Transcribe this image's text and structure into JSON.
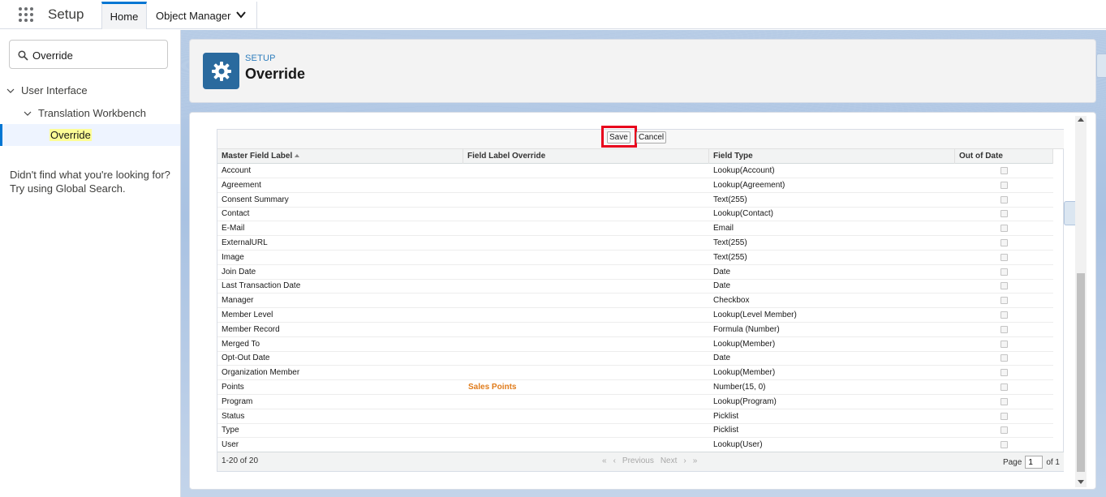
{
  "topbar": {
    "app_title": "Setup",
    "tab_home": "Home",
    "tab_object_manager": "Object Manager"
  },
  "sidebar": {
    "search_value": "Override",
    "tree": {
      "level1": "User Interface",
      "level2": "Translation Workbench",
      "level3_selected": "Override"
    },
    "help_line1": "Didn't find what you're looking for?",
    "help_line2": "Try using Global Search."
  },
  "header": {
    "breadcrumb": "SETUP",
    "title": "Override"
  },
  "buttons": {
    "save": "Save",
    "cancel": "Cancel"
  },
  "table": {
    "columns": [
      "Master Field Label",
      "Field Label Override",
      "Field Type",
      "Out of Date"
    ],
    "rows": [
      {
        "label": "Account",
        "override": "",
        "type": "Lookup(Account)"
      },
      {
        "label": "Agreement",
        "override": "",
        "type": "Lookup(Agreement)"
      },
      {
        "label": "Consent Summary",
        "override": "",
        "type": "Text(255)"
      },
      {
        "label": "Contact",
        "override": "",
        "type": "Lookup(Contact)"
      },
      {
        "label": "E-Mail",
        "override": "",
        "type": "Email"
      },
      {
        "label": "ExternalURL",
        "override": "",
        "type": "Text(255)"
      },
      {
        "label": "Image",
        "override": "",
        "type": "Text(255)"
      },
      {
        "label": "Join Date",
        "override": "",
        "type": "Date"
      },
      {
        "label": "Last Transaction Date",
        "override": "",
        "type": "Date"
      },
      {
        "label": "Manager",
        "override": "",
        "type": "Checkbox"
      },
      {
        "label": "Member Level",
        "override": "",
        "type": "Lookup(Level Member)"
      },
      {
        "label": "Member Record",
        "override": "",
        "type": "Formula (Number)"
      },
      {
        "label": "Merged To",
        "override": "",
        "type": "Lookup(Member)"
      },
      {
        "label": "Opt-Out Date",
        "override": "",
        "type": "Date"
      },
      {
        "label": "Organization Member",
        "override": "",
        "type": "Lookup(Member)"
      },
      {
        "label": "Points",
        "override": "Sales Points",
        "type": "Number(15, 0)"
      },
      {
        "label": "Program",
        "override": "",
        "type": "Lookup(Program)"
      },
      {
        "label": "Status",
        "override": "",
        "type": "Picklist"
      },
      {
        "label": "Type",
        "override": "",
        "type": "Picklist"
      },
      {
        "label": "User",
        "override": "",
        "type": "Lookup(User)"
      }
    ]
  },
  "footer": {
    "count": "1-20 of 20",
    "previous": "Previous",
    "next": "Next",
    "page_label": "Page",
    "page_value": "1",
    "of_label": "of 1"
  },
  "colors": {
    "accent": "#0176d3",
    "header_icon": "#2a6a9e",
    "highlight_box": "#e8001c",
    "override_text": "#e07b1a"
  }
}
